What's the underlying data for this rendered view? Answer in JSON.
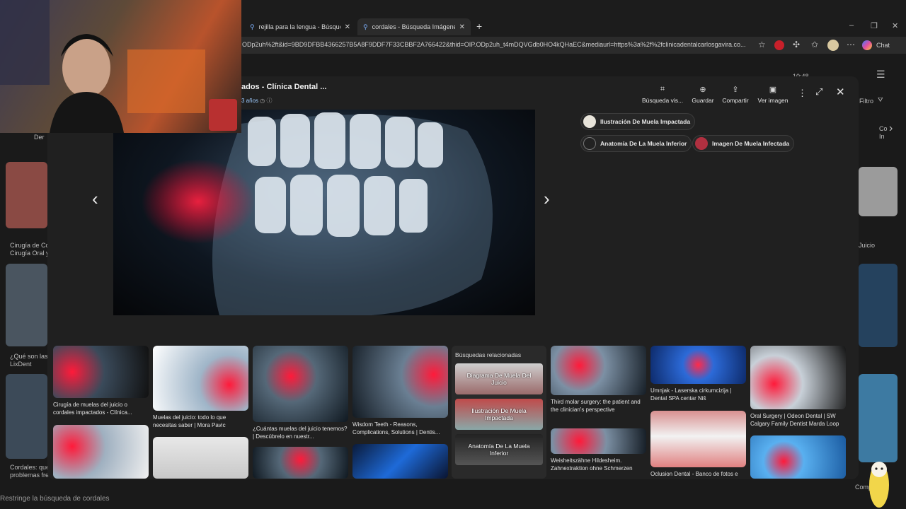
{
  "browser": {
    "tabs": [
      {
        "title": "rejilla para la lengua - Búsqueda",
        "active": false
      },
      {
        "title": "cordales - Búsqueda Imágenes",
        "active": true
      }
    ],
    "new_tab": "+",
    "url": "ODp2uh%2ft&id=9BD9DFBB4366257B5A8F9DDF7F33CBBF2A766422&thid=OIP.ODp2uh_t4mDQVGdb0HO4kQHaEC&mediaurl=https%3a%2f%2fclinicadentalcarlosgavira.co...",
    "chat_label": "Chat"
  },
  "background": {
    "filter_label": "Filtro",
    "time": "10:48",
    "captions": [
      "Cirugía de Cor",
      "Cirugía Oral y",
      "¿Qué son las c",
      "LixDent",
      "Cordales: qué",
      "problemas frec",
      "Juicio",
      "Co",
      "In",
      "Der",
      "Comp"
    ],
    "restrict": "Restringe la búsqueda de cordales"
  },
  "viewer": {
    "title": "ados - Clínica Dental ...",
    "subtitle": "3 años",
    "actions": [
      {
        "icon": "visual-search-icon",
        "label": "Búsqueda vis..."
      },
      {
        "icon": "save-icon",
        "label": "Guardar"
      },
      {
        "icon": "share-icon",
        "label": "Compartir"
      },
      {
        "icon": "view-image-icon",
        "label": "Ver imagen"
      }
    ],
    "chips": [
      {
        "label": "Ilustración De Muela Impactada"
      },
      {
        "label": "Anatomía De La Muela Inferior"
      },
      {
        "label": "Imagen De Muela Infectada"
      }
    ],
    "results": [
      {
        "caption": "Cirugía de muelas del juicio o cordales impactados - Clínica..."
      },
      {
        "caption": "Muelas del juicio: todo lo que necesitas saber | Mora Pavic"
      },
      {
        "caption": "¿Cuántas muelas del juicio tenemos? | Descúbrelo en nuestr..."
      },
      {
        "caption": "Wisdom Teeth - Reasons, Complications, Solutions | Dentis..."
      },
      {
        "caption": "Third molar surgery: the patient and the clinician's perspective"
      },
      {
        "caption": "Umnjak - Laserska cirkumcizija | Dental SPA centar Niš"
      },
      {
        "caption": "Oral Surgery | Odeon Dental | SW Calgary Family Dentist Marda Loop"
      },
      {
        "caption": "Weisheitszähne Hildesheim. Zahnextraktion ohne Schmerzen"
      },
      {
        "caption": "Oclusion Dental - Banco de fotos e"
      }
    ],
    "related": {
      "header": "Búsquedas relacionadas",
      "items": [
        "Diagrama De Muela Del Juicio",
        "Ilustración De Muela Impactada",
        "Anatomía De La Muela Inferior"
      ]
    }
  }
}
